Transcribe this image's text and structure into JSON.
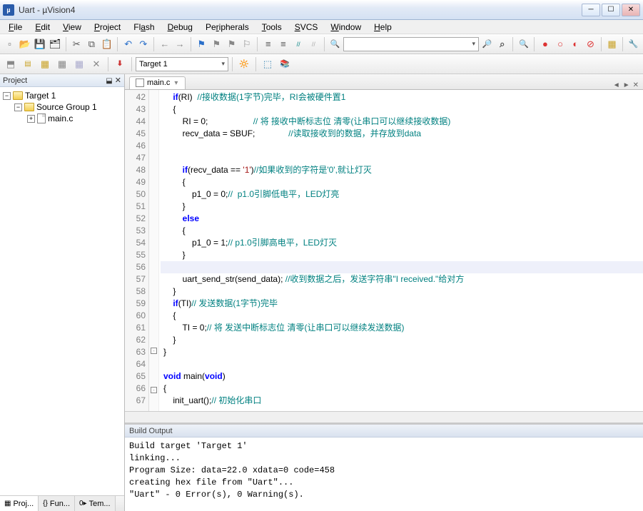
{
  "title": "Uart  - µVision4",
  "menu": [
    "File",
    "Edit",
    "View",
    "Project",
    "Flash",
    "Debug",
    "Peripherals",
    "Tools",
    "SVCS",
    "Window",
    "Help"
  ],
  "toolbar2_target": "Target 1",
  "project": {
    "header": "Project",
    "target": "Target 1",
    "group": "Source Group 1",
    "file": "main.c",
    "tabs": [
      "Proj...",
      "Fun...",
      "Tem..."
    ]
  },
  "editor": {
    "tab": "main.c",
    "lines": [
      {
        "n": 42,
        "html": "    <span class=kw>if</span>(RI)  <span class=cm>//接收数据(1字节)完毕，RI会被硬件置1</span>"
      },
      {
        "n": 43,
        "html": "    {"
      },
      {
        "n": 44,
        "html": "        RI = 0;                   <span class=cm>// 将 接收中断标志位 清零(让串口可以继续接收数据)</span>"
      },
      {
        "n": 45,
        "html": "        recv_data = SBUF;              <span class=cm>//读取接收到的数据，并存放到data</span>"
      },
      {
        "n": 46,
        "html": ""
      },
      {
        "n": 47,
        "html": ""
      },
      {
        "n": 48,
        "html": "        <span class=kw>if</span>(recv_data == <span class=st>'1'</span>)<span class=cm>//如果收到的字符是'0',就让灯灭</span>"
      },
      {
        "n": 49,
        "html": "        {"
      },
      {
        "n": 50,
        "html": "            p1_0 = 0;<span class=cm>//  p1.0引脚低电平，LED灯亮</span>"
      },
      {
        "n": 51,
        "html": "        }"
      },
      {
        "n": 52,
        "html": "        <span class=kw>else</span>"
      },
      {
        "n": 53,
        "html": "        {"
      },
      {
        "n": 54,
        "html": "            p1_0 = 1;<span class=cm>// p1.0引脚高电平，LED灯灭</span>"
      },
      {
        "n": 55,
        "html": "        }"
      },
      {
        "n": 56,
        "hl": true,
        "html": ""
      },
      {
        "n": 57,
        "html": "        uart_send_str(send_data); <span class=cm>//收到数据之后，发送字符串\"I received.\"给对方</span>"
      },
      {
        "n": 58,
        "html": "    }"
      },
      {
        "n": 59,
        "html": "    <span class=kw>if</span>(TI)<span class=cm>// 发送数据(1字节)完毕</span>"
      },
      {
        "n": 60,
        "html": "    {"
      },
      {
        "n": 61,
        "html": "        TI = 0;<span class=cm>// 将 发送中断标志位 清零(让串口可以继续发送数据)</span>"
      },
      {
        "n": 62,
        "html": "    }"
      },
      {
        "n": 63,
        "fold": "-",
        "html": "}"
      },
      {
        "n": 64,
        "html": ""
      },
      {
        "n": 65,
        "html": "<span class=kw>void</span> main(<span class=kw>void</span>)"
      },
      {
        "n": 66,
        "fold": "-",
        "html": "{"
      },
      {
        "n": 67,
        "html": "    init_uart();<span class=cm>// 初始化串口</span>"
      }
    ]
  },
  "build": {
    "header": "Build Output",
    "lines": [
      "Build target 'Target 1'",
      "linking...",
      "Program Size: data=22.0 xdata=0 code=458",
      "creating hex file from \"Uart\"...",
      "\"Uart\" - 0 Error(s), 0 Warning(s)."
    ]
  }
}
